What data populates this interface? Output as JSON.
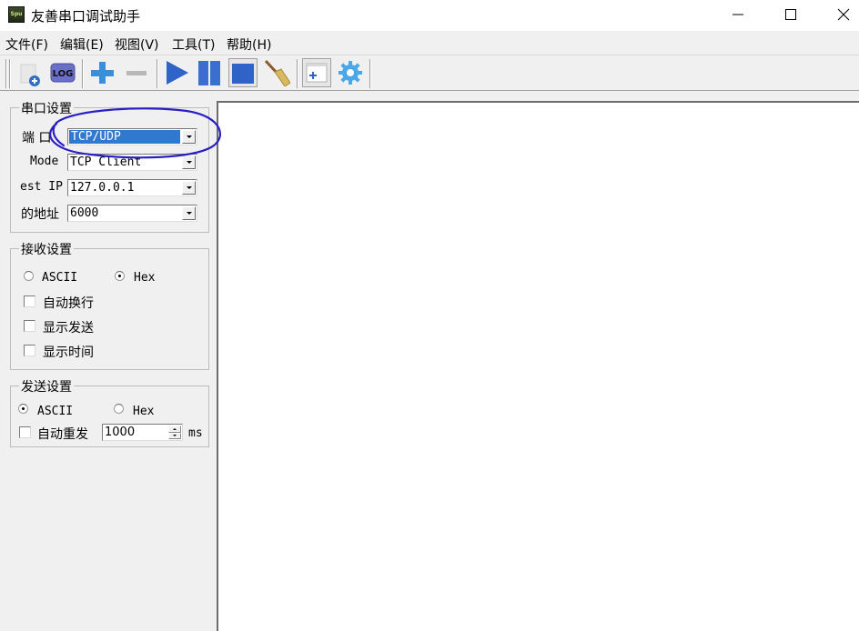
{
  "window": {
    "title": "友善串口调试助手",
    "app_icon_text": "Spu",
    "controls": [
      "minimize",
      "maximize",
      "close"
    ]
  },
  "menu": {
    "items": [
      {
        "label": "文件(F)"
      },
      {
        "label": "编辑(E)"
      },
      {
        "label": "视图(V)"
      },
      {
        "label": "工具(T)"
      },
      {
        "label": "帮助(H)"
      }
    ]
  },
  "toolbar": {
    "buttons": [
      {
        "icon": "new-port-icon",
        "name": "open-port"
      },
      {
        "icon": "log-icon",
        "name": "log",
        "text": "LOG"
      },
      {
        "icon": "plus-icon",
        "name": "add"
      },
      {
        "icon": "minus-icon",
        "name": "remove"
      },
      {
        "icon": "play-icon",
        "name": "start"
      },
      {
        "icon": "pause-icon",
        "name": "pause"
      },
      {
        "icon": "stop-icon",
        "name": "stop",
        "pressed": true
      },
      {
        "icon": "broom-icon",
        "name": "clear"
      },
      {
        "icon": "new-window-icon",
        "name": "new-window"
      },
      {
        "icon": "gear-icon",
        "name": "settings"
      }
    ]
  },
  "port_settings": {
    "legend": "串口设置",
    "port_label": "端  口",
    "port_value": "TCP/UDP",
    "mode_label": "Mode",
    "mode_value": "TCP Client",
    "dest_ip_label": "est IP",
    "dest_ip_value": "127.0.0.1",
    "address_label": "的地址",
    "address_value": "6000"
  },
  "receive_settings": {
    "legend": "接收设置",
    "ascii_label": "ASCII",
    "hex_label": "Hex",
    "selected": "Hex",
    "auto_wrap_label": "自动换行",
    "show_send_label": "显示发送",
    "show_time_label": "显示时间"
  },
  "send_settings": {
    "legend": "发送设置",
    "ascii_label": "ASCII",
    "hex_label": "Hex",
    "selected": "ASCII",
    "auto_resend_label": "自动重发",
    "interval_value": "1000",
    "unit": "ms"
  },
  "colors": {
    "selection": "#3078d0",
    "annotation_ink": "#2a1fc4"
  }
}
